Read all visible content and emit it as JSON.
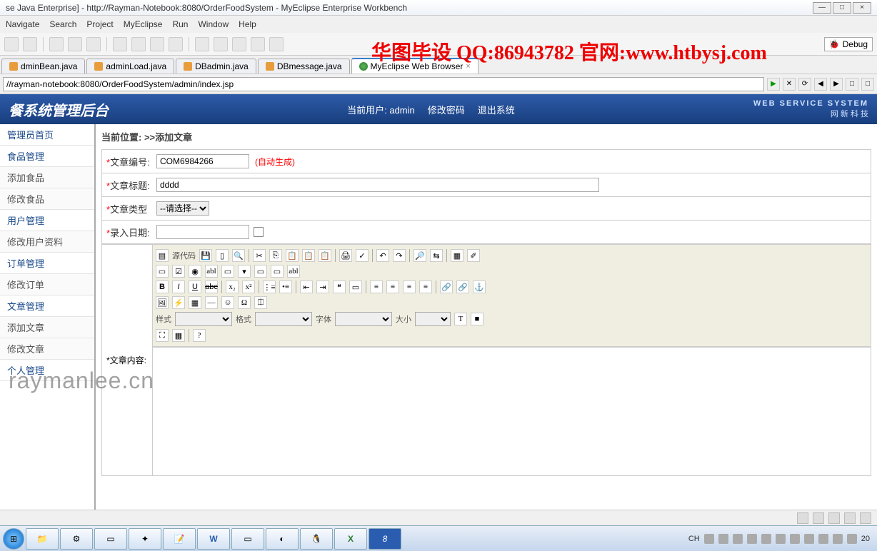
{
  "window": {
    "title": "se Java Enterprise] - http://Rayman-Notebook:8080/OrderFoodSystem - MyEclipse Enterprise Workbench"
  },
  "menu": [
    "Navigate",
    "Search",
    "Project",
    "MyEclipse",
    "Run",
    "Window",
    "Help"
  ],
  "debug_label": "Debug",
  "watermark1": "华图毕设 QQ:86943782 官网:www.htbysj.com",
  "watermark2": "raymanlee.cn",
  "editor_tabs": [
    {
      "label": "dminBean.java"
    },
    {
      "label": "adminLoad.java"
    },
    {
      "label": "DBadmin.java"
    },
    {
      "label": "DBmessage.java"
    },
    {
      "label": "MyEclipse Web Browser",
      "active": true
    }
  ],
  "address": "//rayman-notebook:8080/OrderFoodSystem/admin/index.jsp",
  "app": {
    "title": "餐系统管理后台",
    "user_prefix": "当前用户:",
    "user": "admin",
    "link_pwd": "修改密码",
    "link_logout": "退出系统",
    "ws1": "WEB SERVICE SYSTEM",
    "ws2": "网 新 科 技"
  },
  "sidebar": [
    {
      "label": "管理员首页",
      "sub": false
    },
    {
      "label": "食品管理",
      "sub": false
    },
    {
      "label": "添加食品",
      "sub": true
    },
    {
      "label": "修改食品",
      "sub": true
    },
    {
      "label": "用户管理",
      "sub": false
    },
    {
      "label": "修改用户资料",
      "sub": true
    },
    {
      "label": "订单管理",
      "sub": false
    },
    {
      "label": "修改订单",
      "sub": true
    },
    {
      "label": "文章管理",
      "sub": false
    },
    {
      "label": "添加文章",
      "sub": true
    },
    {
      "label": "修改文章",
      "sub": true
    },
    {
      "label": "个人管理",
      "sub": false
    }
  ],
  "breadcrumb_prefix": "当前位置: >>",
  "breadcrumb_current": "添加文章",
  "form": {
    "id_label": "文章编号:",
    "id_value": "COM6984266",
    "auto": "(自动生成)",
    "title_label": "文章标题:",
    "title_value": "dddd",
    "type_label": "文章类型",
    "type_placeholder": "--请选择--",
    "date_label": "录入日期:",
    "date_value": "",
    "content_label": "文章内容:"
  },
  "rte": {
    "source": "源代码",
    "style": "样式",
    "format": "格式",
    "font": "字体",
    "size": "大小"
  },
  "tray": {
    "ime": "CH",
    "time": "20"
  }
}
